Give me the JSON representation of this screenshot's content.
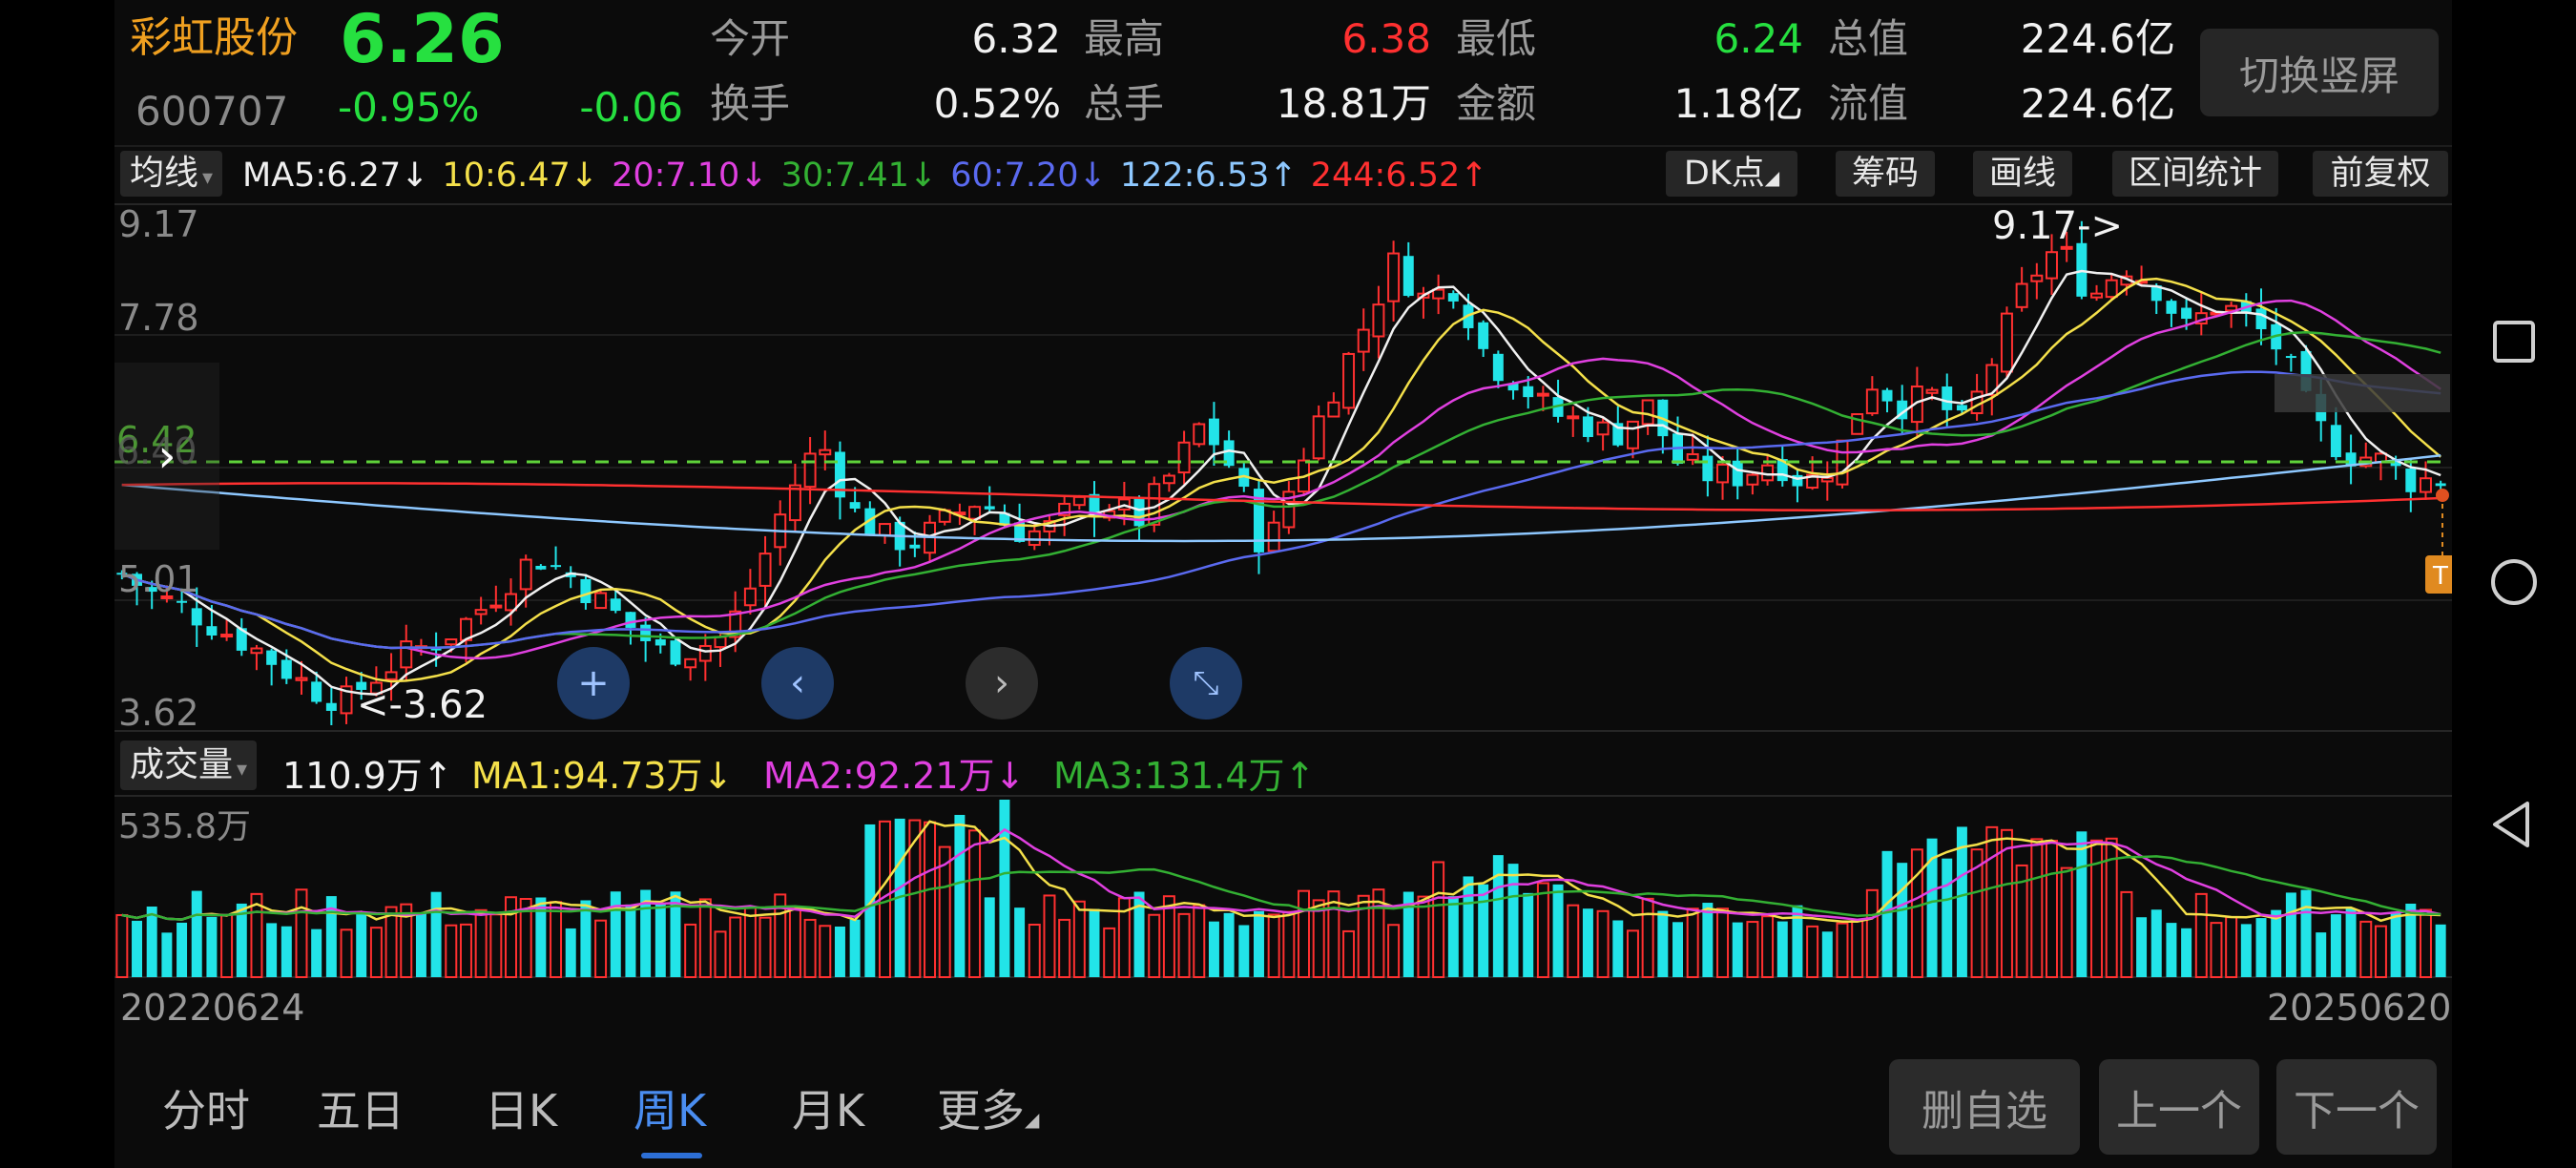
{
  "quote": {
    "name": "彩虹股份",
    "code": "600707",
    "price": "6.26",
    "change_pct": "-0.95%",
    "change": "-0.06",
    "open_label": "今开",
    "open": "6.32",
    "high_label": "最高",
    "high": "6.38",
    "low_label": "最低",
    "low": "6.24",
    "mcap_label": "总值",
    "mcap": "224.6亿",
    "turnover_label": "换手",
    "turnover": "0.52%",
    "volume_label": "总手",
    "volume": "18.81万",
    "amount_label": "金额",
    "amount": "1.18亿",
    "float_label": "流值",
    "float_mcap": "224.6亿",
    "switch_btn": "切换竖屏"
  },
  "ma_bar": {
    "dropdown": "均线",
    "items": [
      {
        "text": "MA5:6.27↓",
        "color": "#f0f0f0"
      },
      {
        "text": "10:6.47↓",
        "color": "#f4e04a"
      },
      {
        "text": "20:7.10↓",
        "color": "#e040e0"
      },
      {
        "text": "30:7.41↓",
        "color": "#33b033"
      },
      {
        "text": "60:7.20↓",
        "color": "#5a6af0"
      },
      {
        "text": "122:6.53↑",
        "color": "#8ec8ff"
      },
      {
        "text": "244:6.52↑",
        "color": "#ff3030"
      }
    ],
    "buttons": [
      "DK点",
      "筹码",
      "画线",
      "区间统计",
      "前复权"
    ]
  },
  "price_axis": {
    "top": "9.17",
    "l2": "7.78",
    "ref_green": "6.42",
    "ref_grey": "6.40",
    "l4": "5.01",
    "bottom": "3.62"
  },
  "annotations": {
    "high": "9.17->",
    "low": "<-3.62",
    "marker": "T"
  },
  "volume": {
    "dropdown": "成交量",
    "value": "110.9万↑",
    "ma1": "MA1:94.73万↓",
    "ma2": "MA2:92.21万↓",
    "ma3": "MA3:131.4万↑",
    "axis_max": "535.8万"
  },
  "dates": {
    "start": "20220624",
    "end": "20250620"
  },
  "tabs": [
    "分时",
    "五日",
    "日K",
    "周K",
    "月K",
    "更多"
  ],
  "active_tab": "周K",
  "bottom_buttons": [
    "删自选",
    "上一个",
    "下一个"
  ],
  "colors": {
    "up": "#ff3030",
    "down": "#22e4e8",
    "accent": "#2d6fd6"
  },
  "icons": [
    "chevron-right-icon",
    "zoom-in-plus-icon",
    "scroll-left-icon",
    "scroll-right-icon",
    "shrink-icon",
    "square-icon",
    "circle-icon",
    "back-triangle-icon"
  ],
  "chart_data": {
    "type": "candlestick",
    "frequency": "weekly",
    "x_range": [
      "20220624",
      "20250620"
    ],
    "y_range": [
      3.62,
      9.17
    ],
    "reference_line": 6.42,
    "close_path": [
      5.2,
      4.95,
      4.8,
      4.6,
      4.4,
      4.15,
      3.9,
      3.75,
      4.05,
      4.3,
      4.45,
      4.7,
      5.05,
      5.4,
      5.2,
      4.9,
      4.6,
      4.3,
      4.35,
      4.5,
      5.2,
      6.1,
      6.7,
      5.9,
      5.6,
      5.55,
      5.8,
      6.05,
      5.7,
      5.65,
      5.95,
      6.0,
      5.8,
      6.3,
      6.9,
      6.35,
      5.4,
      6.4,
      7.2,
      7.9,
      8.7,
      8.3,
      8.45,
      7.6,
      7.35,
      7.0,
      6.9,
      6.75,
      7.1,
      6.45,
      6.3,
      6.3,
      6.5,
      6.2,
      6.5,
      7.4,
      7.1,
      7.2,
      6.85,
      7.7,
      8.5,
      8.9,
      8.3,
      8.7,
      8.45,
      7.95,
      8.25,
      8.05,
      7.7,
      6.9,
      6.55,
      6.5,
      6.25,
      6.26
    ]
  }
}
